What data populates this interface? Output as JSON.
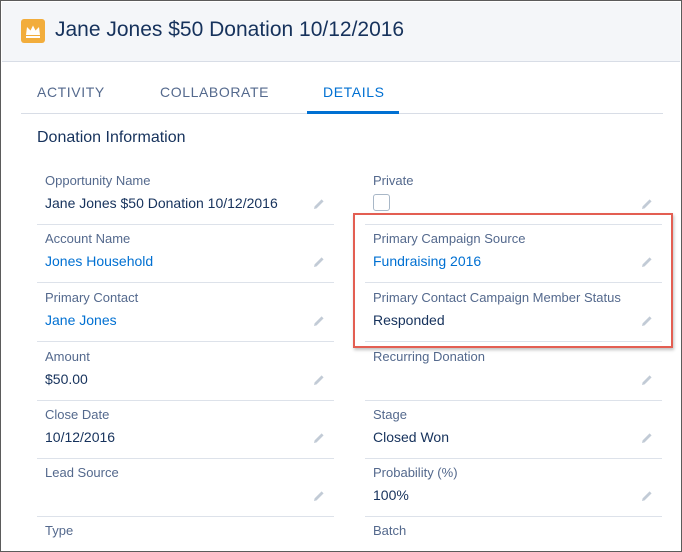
{
  "header": {
    "title": "Jane Jones $50 Donation 10/12/2016",
    "icon": "crown-icon",
    "icon_color": "#f2ad3c"
  },
  "tabs": [
    {
      "label": "ACTIVITY"
    },
    {
      "label": "COLLABORATE"
    },
    {
      "label": "DETAILS",
      "active": true
    }
  ],
  "section": {
    "title": "Donation Information"
  },
  "fields": {
    "opportunity_name": {
      "label": "Opportunity Name",
      "value": "Jane Jones $50 Donation 10/12/2016"
    },
    "private": {
      "label": "Private",
      "checked": false
    },
    "account_name": {
      "label": "Account Name",
      "value": "Jones Household"
    },
    "primary_campaign_source": {
      "label": "Primary Campaign Source",
      "value": "Fundraising 2016"
    },
    "primary_contact": {
      "label": "Primary Contact",
      "value": "Jane Jones"
    },
    "primary_contact_campaign_member_status": {
      "label": "Primary Contact Campaign Member Status",
      "value": "Responded"
    },
    "amount": {
      "label": "Amount",
      "value": "$50.00"
    },
    "recurring_donation": {
      "label": "Recurring Donation",
      "value": ""
    },
    "close_date": {
      "label": "Close Date",
      "value": "10/12/2016"
    },
    "stage": {
      "label": "Stage",
      "value": "Closed Won"
    },
    "lead_source": {
      "label": "Lead Source",
      "value": ""
    },
    "probability": {
      "label": "Probability (%)",
      "value": "100%"
    },
    "type": {
      "label": "Type",
      "value": ""
    },
    "batch": {
      "label": "Batch",
      "value": ""
    }
  },
  "colors": {
    "link": "#0070d2",
    "highlight": "#e35e52"
  }
}
